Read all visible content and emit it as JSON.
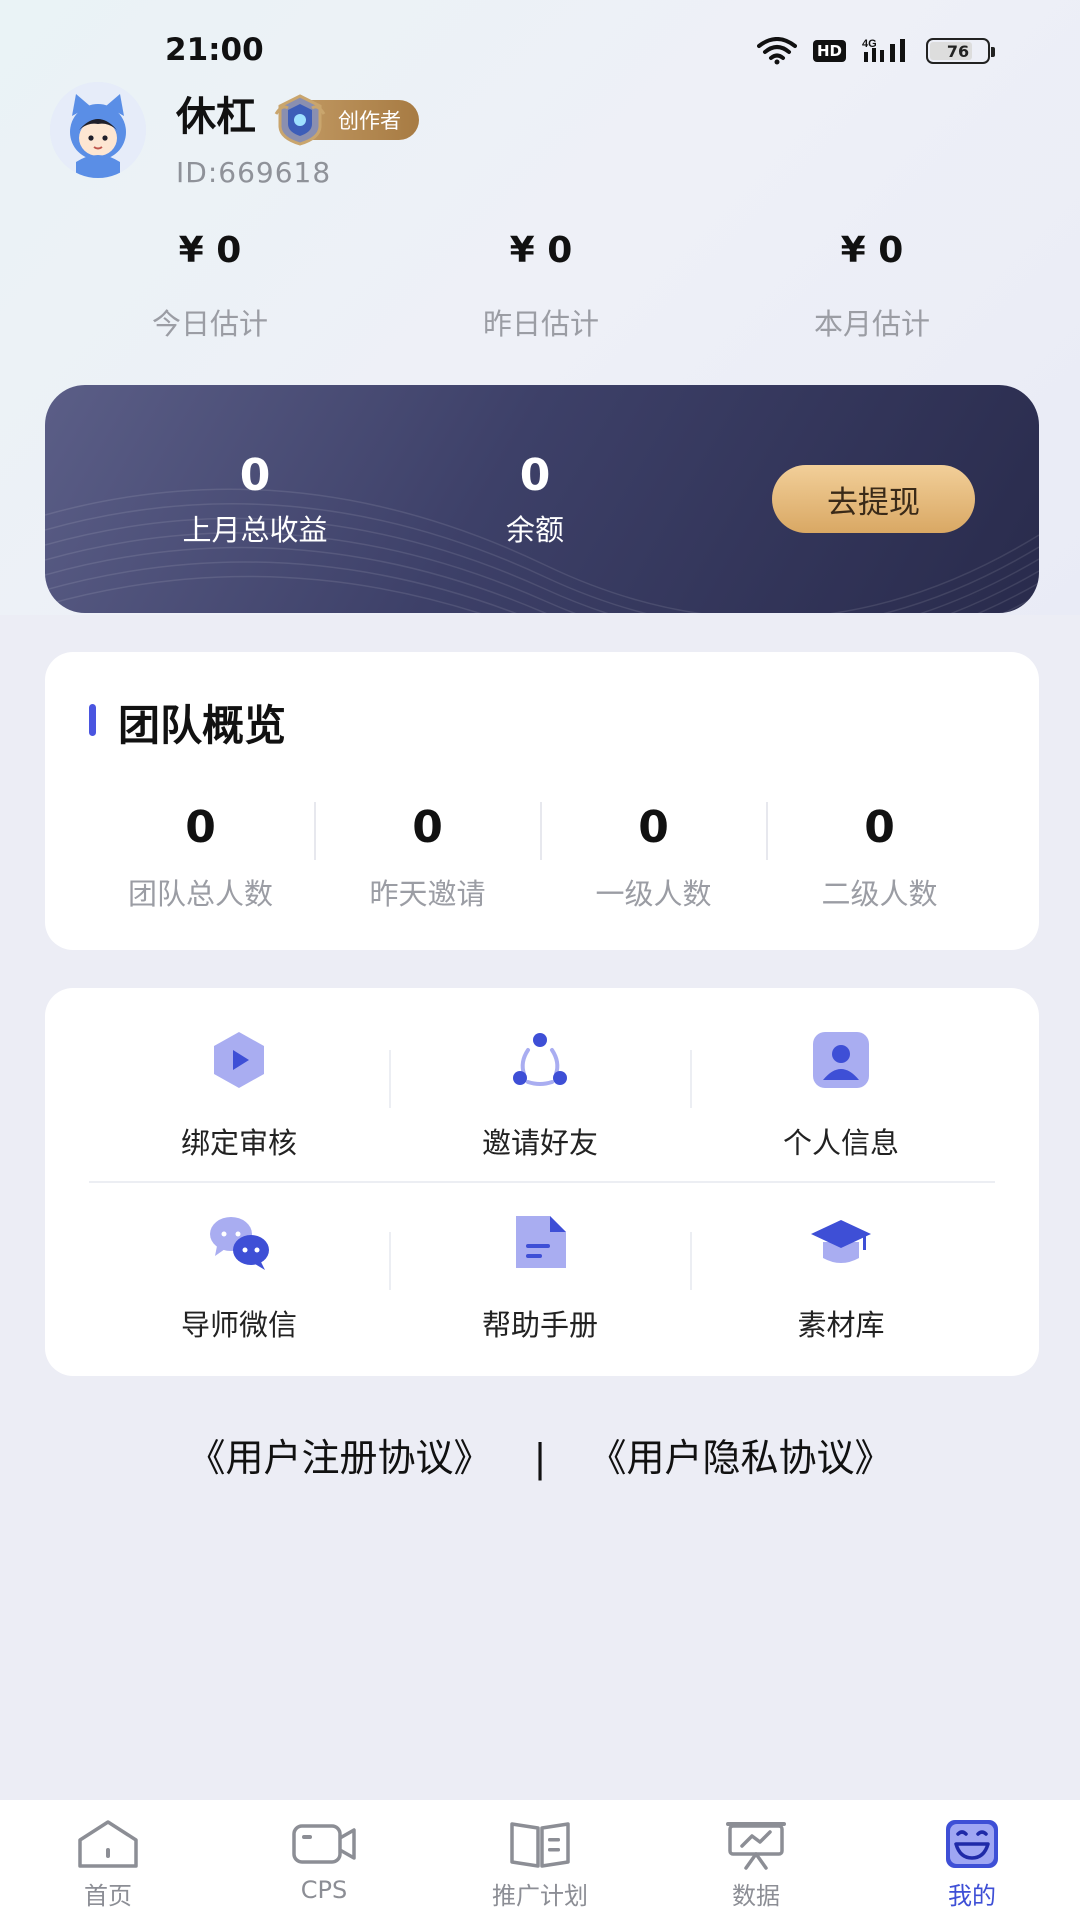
{
  "status_bar": {
    "time": "21:00",
    "hd": "HD",
    "network": "4G",
    "battery": "76",
    "battery_level": 0.76
  },
  "profile": {
    "name": "休杠",
    "badge": "创作者",
    "id": "ID:669618",
    "avatar_icon": "avatar-cat-hood"
  },
  "estimates": [
    {
      "value": "¥ 0",
      "label": "今日估计"
    },
    {
      "value": "¥ 0",
      "label": "昨日估计"
    },
    {
      "value": "¥ 0",
      "label": "本月估计"
    }
  ],
  "earnings": {
    "last_month_value": "0",
    "last_month_label": "上月总收益",
    "balance_value": "0",
    "balance_label": "余额",
    "withdraw_label": "去提现"
  },
  "team": {
    "title": "团队概览",
    "stats": [
      {
        "value": "0",
        "label": "团队总人数"
      },
      {
        "value": "0",
        "label": "昨天邀请"
      },
      {
        "value": "0",
        "label": "一级人数"
      },
      {
        "value": "0",
        "label": "二级人数"
      }
    ]
  },
  "tools": [
    {
      "label": "绑定审核",
      "icon": "play-hexagon-icon"
    },
    {
      "label": "邀请好友",
      "icon": "share-nodes-icon"
    },
    {
      "label": "个人信息",
      "icon": "person-card-icon"
    },
    {
      "label": "导师微信",
      "icon": "wechat-icon"
    },
    {
      "label": "帮助手册",
      "icon": "document-icon"
    },
    {
      "label": "素材库",
      "icon": "graduation-cap-icon"
    }
  ],
  "agreements": {
    "register": "《用户注册协议》",
    "separator": "|",
    "privacy": "《用户隐私协议》"
  },
  "nav": [
    {
      "label": "首页",
      "icon": "home-icon"
    },
    {
      "label": "CPS",
      "icon": "video-camera-icon"
    },
    {
      "label": "推广计划",
      "icon": "book-icon"
    },
    {
      "label": "数据",
      "icon": "presentation-chart-icon"
    },
    {
      "label": "我的",
      "icon": "smiley-face-icon",
      "active": true
    }
  ],
  "colors": {
    "accent": "#3e4fd6",
    "icon_tint": "#8b90e8",
    "card_dark": "#2e3052",
    "gold": "#d9a864"
  }
}
